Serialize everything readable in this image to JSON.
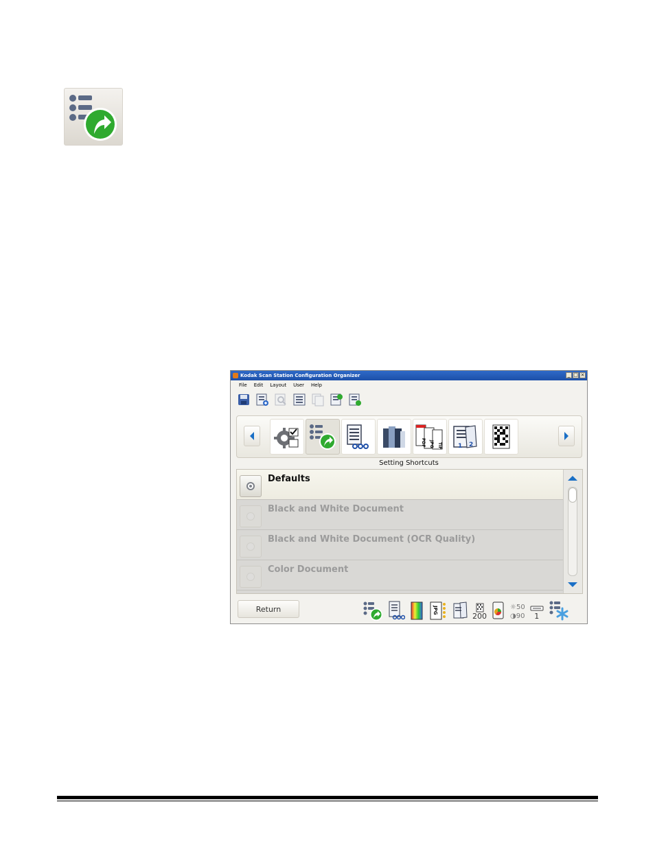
{
  "window": {
    "title": "Kodak Scan Station Configuration Organizer",
    "controls": {
      "minimize": "_",
      "maximize": "□",
      "close": "×"
    }
  },
  "menubar": [
    "File",
    "Edit",
    "Layout",
    "User",
    "Help"
  ],
  "toolbar": {
    "buttons": [
      {
        "icon": "save-icon",
        "enabled": true
      },
      {
        "icon": "add-config-icon",
        "enabled": true
      },
      {
        "icon": "search-config-icon",
        "enabled": false
      },
      {
        "icon": "list-config-icon",
        "enabled": true
      },
      {
        "icon": "copy-config-icon",
        "enabled": false
      },
      {
        "icon": "export-config-icon",
        "enabled": true
      },
      {
        "icon": "import-config-icon",
        "enabled": true
      }
    ]
  },
  "categories": {
    "caption": "Setting Shortcuts",
    "items": [
      {
        "icon": "device-settings-icon",
        "selected": false
      },
      {
        "icon": "setting-shortcuts-icon",
        "selected": true
      },
      {
        "icon": "document-settings-icon",
        "selected": false
      },
      {
        "icon": "color-settings-icon",
        "selected": false
      },
      {
        "icon": "file-types-icon",
        "labels": [
          "PDF",
          "JPG",
          "TIF"
        ],
        "selected": false
      },
      {
        "icon": "page-numbering-icon",
        "labels": [
          "1",
          "2"
        ],
        "selected": false
      },
      {
        "icon": "barcode-icon",
        "selected": false
      }
    ]
  },
  "shortcuts": [
    {
      "label": "Defaults",
      "selected": true
    },
    {
      "label": "Black and White Document",
      "selected": false
    },
    {
      "label": "Black and White Document (OCR Quality)",
      "selected": false
    },
    {
      "label": "Color Document",
      "selected": false
    }
  ],
  "bottom": {
    "return_label": "Return",
    "status": {
      "resolution": "200",
      "brightness": "☼50",
      "contrast": "◑90",
      "copies": "1"
    }
  },
  "colors": {
    "title_bar": "#1c4fa8",
    "accent_green": "#2faa2f",
    "icon_slate": "#5b6a86",
    "arrow_blue": "#1a6fc6"
  }
}
